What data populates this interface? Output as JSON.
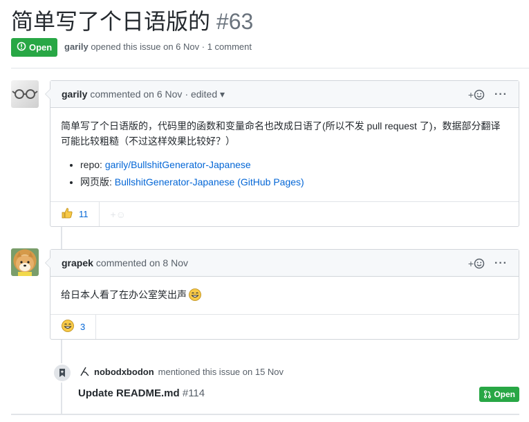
{
  "issue": {
    "title": "简单写了个日语版的",
    "number": "#63",
    "state": "Open",
    "author": "garily",
    "meta_rest": "opened this issue on 6 Nov · 1 comment"
  },
  "comments": [
    {
      "author": "garily",
      "meta": "commented on 6 Nov",
      "edited": "· edited",
      "body": "简单写了个日语版的，代码里的函数和变量命名也改成日语了(所以不发 pull request 了)，数据部分翻译可能比较粗糙（不过这样效果比较好？）",
      "list": [
        {
          "prefix": "repo: ",
          "link": "garily/BullshitGenerator-Japanese"
        },
        {
          "prefix": "网页版: ",
          "link": "BullshitGenerator-Japanese (GitHub Pages)"
        }
      ],
      "reaction_count": "11",
      "reaction_icon": "thumbs-up-icon"
    },
    {
      "author": "grapek",
      "meta": "commented on 8 Nov",
      "body": "给日本人看了在办公室笑出声",
      "reaction_count": "3",
      "reaction_icon": "laugh-icon"
    }
  ],
  "event": {
    "actor": "nobodxbodon",
    "text": "mentioned this issue on 15 Nov",
    "ref_title": "Update README.md",
    "ref_number": "#114",
    "ref_state": "Open"
  },
  "colors": {
    "open_green": "#28a745",
    "link_blue": "#0366d6",
    "muted_gray": "#586069"
  }
}
